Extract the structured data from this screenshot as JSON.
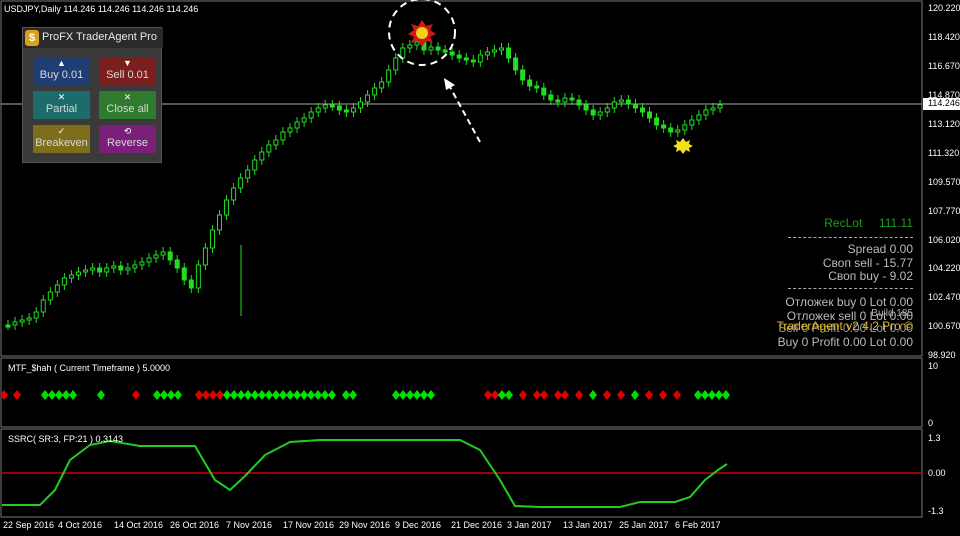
{
  "chart": {
    "symbol_label": "USDJPY,Daily  114.246 114.246 114.246 114.246",
    "current_price": "114.246",
    "price_scale": [
      "120.220",
      "118.420",
      "116.670",
      "114.870",
      "113.120",
      "111.320",
      "109.570",
      "107.770",
      "106.020",
      "104.220",
      "102.470",
      "100.670",
      "98.920"
    ],
    "date_axis": [
      "22 Sep 2016",
      "4 Oct 2016",
      "14 Oct 2016",
      "26 Oct 2016",
      "7 Nov 2016",
      "17 Nov 2016",
      "29 Nov 2016",
      "9 Dec 2016",
      "21 Dec 2016",
      "3 Jan 2017",
      "13 Jan 2017",
      "25 Jan 2017",
      "6 Feb 2017"
    ]
  },
  "panel": {
    "title": "ProFX TraderAgent Pro",
    "buy_label": "Buy 0.01",
    "sell_label": "Sell 0.01",
    "partial_label": "Partial",
    "closeall_label": "Close all",
    "breakeven_label": "Breakeven",
    "reverse_label": "Reverse",
    "logo_glyph": "$"
  },
  "info": {
    "reclot_label": "RecLot",
    "reclot_value": "111.11",
    "spread": "Spread    0.00",
    "own_sell": "Своп sell  - 15.77",
    "own_buy": "Своп buy  - 9.02",
    "pending_buy": "Отложек buy 0  Lot 0.00",
    "pending_sell": "Отложек sell 0  Lot 0.00",
    "build": "Build 185",
    "version": "TraderAgent v2.4.2 Pro ©",
    "sell_summary": "Sell 0  Profit 0.00  Lot 0.00",
    "buy_summary": "Buy 0  Profit 0.00  Lot 0.00"
  },
  "indicator1": {
    "label": "MTF_$hah ( Current Timeframe )  5.0000",
    "scale_top": "10",
    "scale_bottom": "0",
    "colors": {
      "up": "#00e000",
      "down": "#e00000"
    }
  },
  "indicator2": {
    "label": "SSRC( SR:3, FP:21 )  0.3143",
    "scale_top": "1.3",
    "scale_mid": "0.00",
    "scale_bottom": "-1.3",
    "line_color": "#22cc22",
    "zero_color": "#cc0000"
  }
}
